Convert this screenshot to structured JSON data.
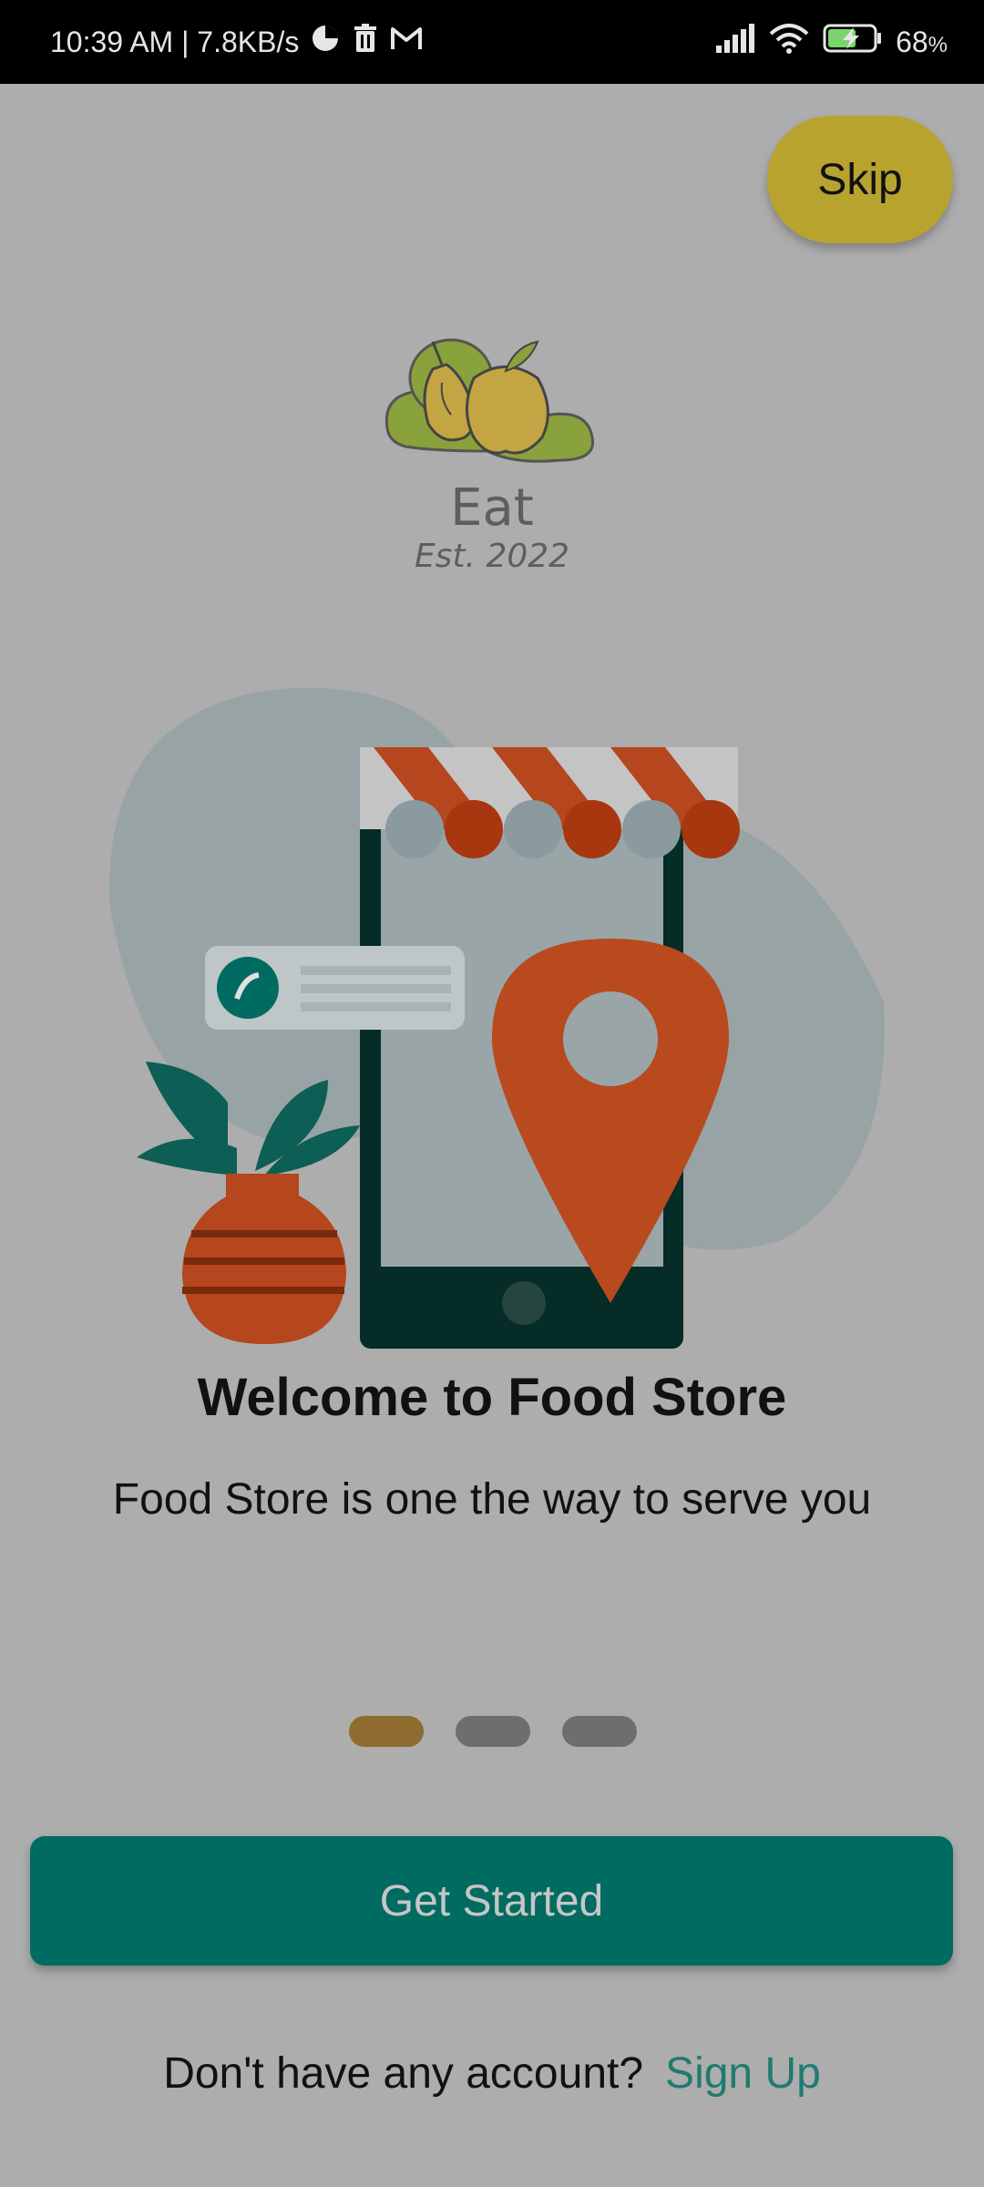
{
  "status_bar": {
    "time_speed": "10:39 AM | 7.8KB/s",
    "battery": "68",
    "battery_unit": "%",
    "icons": [
      "pie-chart-icon",
      "trash-icon",
      "gmail-icon",
      "signal-icon",
      "wifi-icon",
      "battery-charging-icon"
    ]
  },
  "skip_label": "Skip",
  "logo": {
    "name": "Eat",
    "tagline": "Est. 2022"
  },
  "onboarding": {
    "title": "Welcome to Food Store",
    "subtitle": "Food Store is one the way to serve you",
    "page_indicator": {
      "total": 3,
      "current": 1
    }
  },
  "cta": {
    "get_started_label": "Get Started"
  },
  "footer": {
    "prompt": "Don't have any account?",
    "signup_label": "Sign Up"
  },
  "colors": {
    "overlay_bg": "#adadad",
    "skip_bg": "#b8a32f",
    "primary": "#006b60",
    "indicator_active": "#8e6b2e",
    "indicator_inactive": "#6e6e6e",
    "link": "#1e7b70"
  }
}
